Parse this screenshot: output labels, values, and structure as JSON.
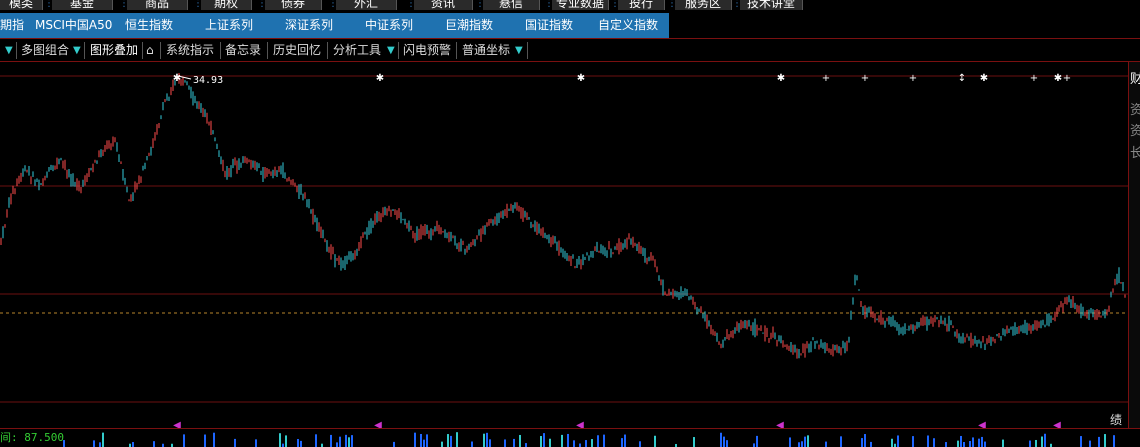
{
  "top_menu": [
    "模类",
    "基金",
    "商品",
    "期权",
    "债券",
    "外汇",
    "资讯",
    "悬信",
    "专业数据",
    "投行",
    "服务区",
    "技术讲堂"
  ],
  "tabs": [
    "期指",
    "MSCI中国A50",
    "恒生指数",
    "上证系列",
    "深证系列",
    "中证系列",
    "巨潮指数",
    "国证指数",
    "自定义指数"
  ],
  "toolbar": {
    "multi_chart": "多图组合",
    "overlay": "图形叠加",
    "system_indicator": "系统指示",
    "memo": "备忘录",
    "history": "历史回忆",
    "analysis_tools": "分析工具",
    "flash_alert": "闪电预警",
    "normal_axis": "普通坐标"
  },
  "chart": {
    "high_label": "34.93",
    "bottom_left_label": "87.500",
    "bottom_right_label": "绩",
    "colors": {
      "up": "#ff4b4b",
      "down": "#33ccdd",
      "grid": "#6b1010",
      "ref_line": "#b8862b",
      "marker": "#cc33cc",
      "volume": "#1e66ff"
    }
  },
  "right_panel": {
    "items": [
      "财",
      "资",
      "资",
      "长"
    ]
  }
}
